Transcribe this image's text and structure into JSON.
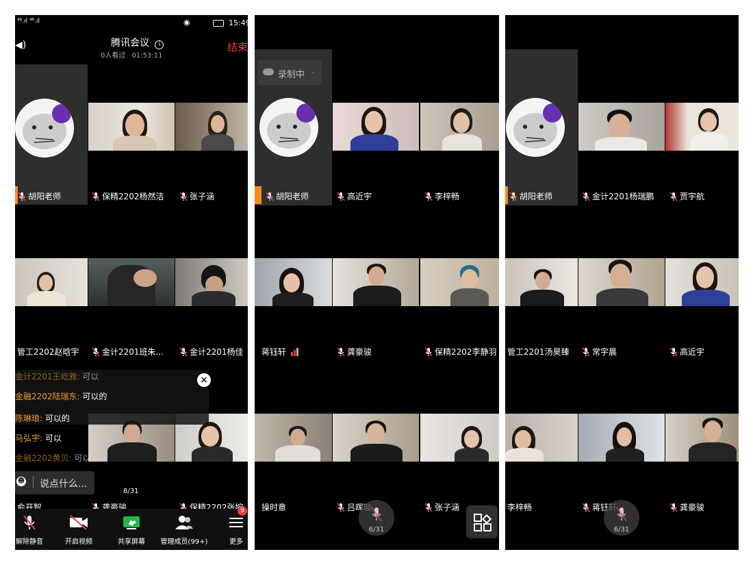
{
  "status_bar": {
    "time": "15:49",
    "left_text": "⁴⁶.ıl ⁴⁶.ıl"
  },
  "meeting": {
    "title": "腾讯会议",
    "viewers": "0人看过",
    "duration": "01:53:11",
    "end_label": "结束"
  },
  "panel1": {
    "tiles": [
      {
        "name": "胡阳老师"
      },
      {
        "name": "保精2202杨然洁"
      },
      {
        "name": "张子涵"
      },
      {
        "name": "管工2202赵晗宇"
      },
      {
        "name": "金计2201班朱..."
      },
      {
        "name": "金计2201杨佳"
      },
      {
        "name": "俞开智"
      },
      {
        "name": "龚豪骏"
      },
      {
        "name": "保精2202张婉"
      }
    ],
    "chat": [
      {
        "sender": "金计2201王屹雅: ",
        "text": "可以"
      },
      {
        "sender": "金融2202陆瑞东: ",
        "text": "可以的"
      },
      {
        "sender": "陈琳琅: ",
        "text": "可以的"
      },
      {
        "sender": "马弘宇: ",
        "text": "可以"
      },
      {
        "sender": "金融2202黄贝: ",
        "text": "可以"
      }
    ],
    "chat_placeholder": "说点什么...",
    "page_indicator": "8/31",
    "toolbar": [
      {
        "label": "解除静音"
      },
      {
        "label": "开启视频"
      },
      {
        "label": "共享屏幕"
      },
      {
        "label": "管理成员(99+)"
      },
      {
        "label": "更多"
      }
    ],
    "more_badge": "9"
  },
  "panel2": {
    "recording_label": "录制中",
    "tiles": [
      {
        "name": "胡阳老师"
      },
      {
        "name": "高近宇"
      },
      {
        "name": "李梓畅"
      },
      {
        "name": "蒋钰轩"
      },
      {
        "name": "龚豪骏"
      },
      {
        "name": "保精2202李静羽"
      },
      {
        "name": "操时意"
      },
      {
        "name": "吕晖璇"
      },
      {
        "name": "张子涵"
      }
    ],
    "page_indicator": "6/31"
  },
  "panel3": {
    "tiles": [
      {
        "name": "胡阳老师"
      },
      {
        "name": "金计2201杨瑞鹏"
      },
      {
        "name": "贾宇航"
      },
      {
        "name": "管工2201汤昊臻"
      },
      {
        "name": "常宇晨"
      },
      {
        "name": "高近宇"
      },
      {
        "name": "李梓畅"
      },
      {
        "name": "蒋钰轩"
      },
      {
        "name": "龚豪骏"
      }
    ],
    "page_indicator": "6/31"
  },
  "colors": {
    "end_red": "#e8403a",
    "chat_sender": "#f0a030",
    "muted_red": "#e84040",
    "active_speaker": "#ff8a1f",
    "share_green": "#1fb84b"
  }
}
